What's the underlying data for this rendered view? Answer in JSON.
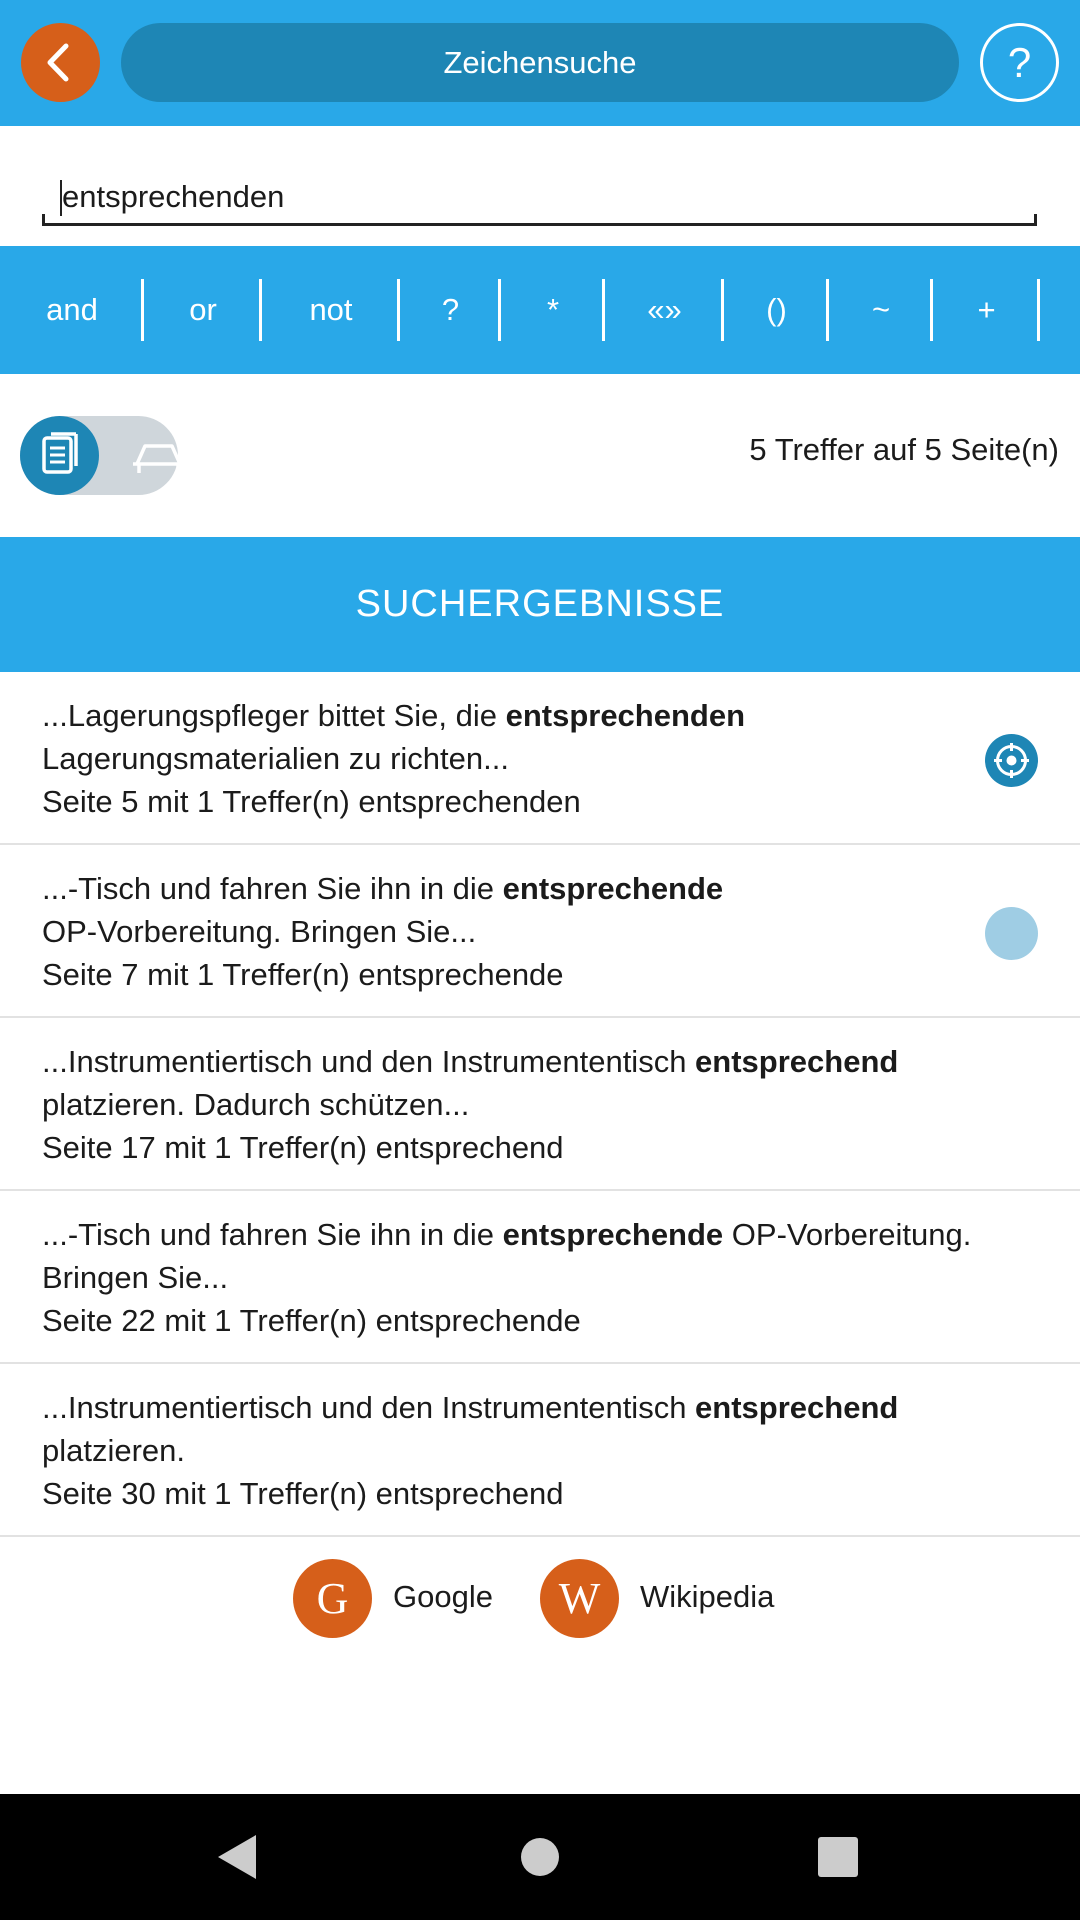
{
  "header": {
    "title": "Zeichensuche",
    "help_label": "?"
  },
  "search": {
    "value": "entsprechenden",
    "placeholder": ""
  },
  "operators": [
    "and",
    "or",
    "not",
    "?",
    "*",
    "«»",
    "()",
    "~",
    "+"
  ],
  "view_toggle": {
    "selected": "document",
    "options": [
      "document-icon",
      "table-icon"
    ]
  },
  "hit_count": "5 Treffer auf 5 Seite(n)",
  "results_header": "SUCHERGEBNISSE",
  "results": [
    {
      "before": "...Lagerungspfleger bittet Sie, die ",
      "match": "entsprechenden",
      "after": "",
      "line2": "Lagerungsmaterialien zu richten...",
      "meta": "Seite 5 mit 1 Treffer(n) entsprechenden",
      "indicator": "active"
    },
    {
      "before": "...-Tisch und fahren Sie ihn in die ",
      "match": "entsprechende",
      "after": "",
      "line2": "OP-Vorbereitung. Bringen Sie...",
      "meta": "Seite 7 mit 1 Treffer(n) entsprechende",
      "indicator": "dim"
    },
    {
      "before": "...Instrumentiertisch und den Instrumententisch ",
      "match": "entsprechend",
      "after": "",
      "line2": "platzieren. Dadurch schützen...",
      "meta": "Seite 17 mit 1 Treffer(n) entsprechend",
      "indicator": "none"
    },
    {
      "before": "...-Tisch und fahren Sie ihn in die ",
      "match": "entsprechende",
      "after": " OP-Vorbereitung.",
      "line2": "Bringen Sie...",
      "meta": "Seite 22 mit 1 Treffer(n) entsprechende",
      "indicator": "none"
    },
    {
      "before": "...Instrumentiertisch und den Instrumententisch ",
      "match": "entsprechend",
      "after": "",
      "line2": "platzieren.",
      "meta": "Seite 30 mit 1 Treffer(n) entsprechend",
      "indicator": "none"
    }
  ],
  "external": {
    "google": {
      "letter": "G",
      "label": "Google"
    },
    "wikipedia": {
      "letter": "W",
      "label": "Wikipedia"
    }
  },
  "colors": {
    "primary": "#29a8e8",
    "primary_dark": "#1e86b5",
    "accent": "#d65f1a"
  }
}
